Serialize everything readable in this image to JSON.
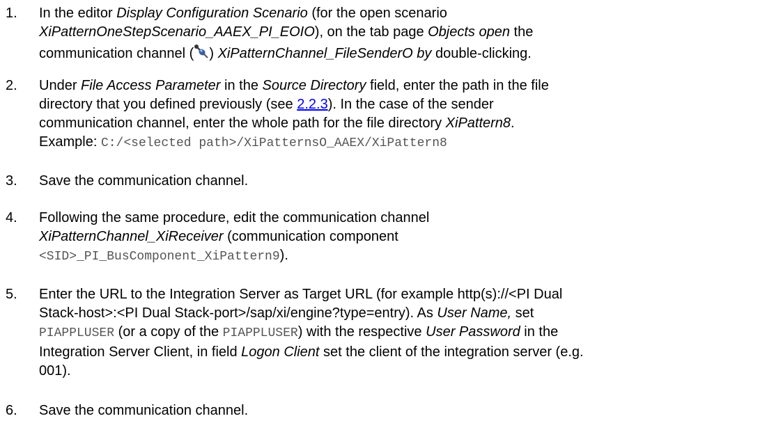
{
  "steps": [
    {
      "number": "1.",
      "t1": "In the editor ",
      "editor_name": "Display Configuration Scenario",
      "t2": " (for the open scenario",
      "scenario_name": "XiPatternOneStepScenario_AAEX_PI_EOIO",
      "t3": "), on the tab page ",
      "tab_name": "Objects open",
      "t4": " the",
      "t5": "communication channel (",
      "t6": ") ",
      "channel_name": "XiPatternChannel_FileSenderO by",
      "t7": " double-clicking."
    },
    {
      "number": "2.",
      "t1": "Under ",
      "param_group": "File Access Parameter",
      "t2": " in the ",
      "field_name": "Source Directory",
      "t3": " field, enter the path in the file",
      "t4": "directory that you defined previously (see ",
      "link_text": "2.2.3",
      "t5": "). In the case of the sender",
      "t6": "communication channel, enter the whole path for the file directory ",
      "dir_name": "XiPattern8",
      "t7": ".",
      "example_label": "Example: ",
      "example_path": "C:/<selected path>/XiPatternsO_AAEX/XiPattern8"
    },
    {
      "number": "3.",
      "text": "Save the communication channel."
    },
    {
      "number": "4.",
      "t1": "Following the same procedure, edit the communication channel",
      "channel_name": "XiPatternChannel_XiReceiver",
      "t2": " (communication component",
      "component": "<SID>_PI_BusComponent_XiPattern9",
      "t3": ")."
    },
    {
      "number": "5.",
      "t1": "Enter the URL to the Integration Server as Target URL (for example http(s)://<PI Dual",
      "t2": "Stack-host>:<PI Dual Stack-port>/sap/xi/engine?type=entry). As ",
      "user_name_label": "User Name,",
      "t3": " set",
      "user1": "PIAPPLUSER",
      "t4": " (or a copy of the ",
      "user2": "PIAPPLUSER",
      "t5": ") with the respective ",
      "password_label": "User Password",
      "t6": " in the",
      "t7": "Integration Server Client, in field ",
      "logon_label": "Logon Client",
      "t8": " set the client of the integration server (e.g.",
      "t9": "001)."
    },
    {
      "number": "6.",
      "text": "Save the communication channel."
    }
  ],
  "icons": {
    "channel_icon": "communication-channel-icon"
  }
}
